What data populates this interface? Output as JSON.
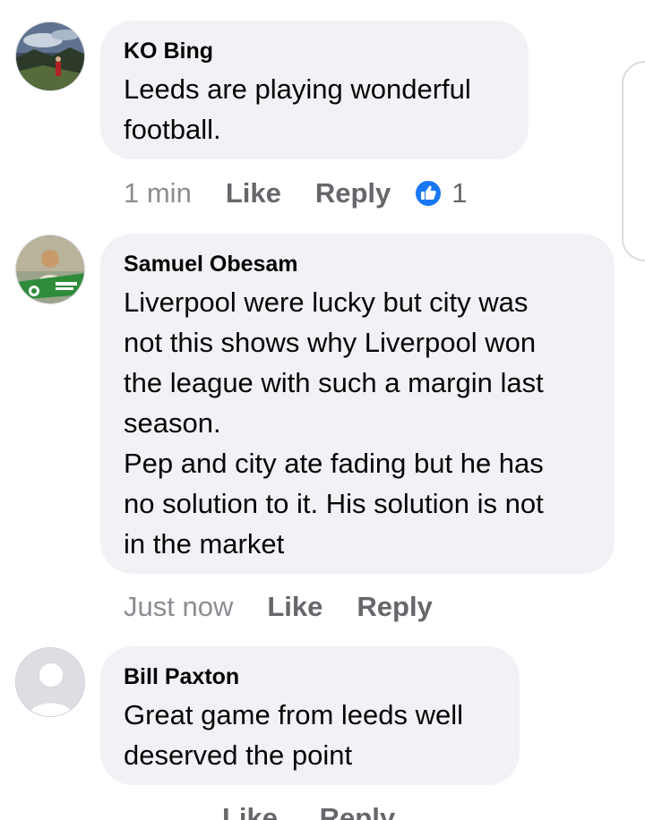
{
  "comments": [
    {
      "author": "KO Bing",
      "text": "Leeds are playing wonderful\nfootball.",
      "time": "1 min",
      "like_label": "Like",
      "reply_label": "Reply",
      "reaction_count": "1",
      "reaction_icon": "like-reaction-icon"
    },
    {
      "author": "Samuel Obesam",
      "text": "Liverpool were lucky but city was\nnot this shows why Liverpool won\nthe league with such a margin last\nseason.\nPep and city ate fading but he has\nno solution to it. His solution is not\nin the market",
      "time": "Just now",
      "like_label": "Like",
      "reply_label": "Reply"
    },
    {
      "author": "Bill Paxton",
      "text": "Great game from leeds well\ndeserved the point",
      "time": "",
      "like_label": "Like",
      "reply_label": "Reply"
    }
  ],
  "colors": {
    "bubble": "#f0f2f5",
    "author": "#050505",
    "meta": "#65676b",
    "reaction_blue": "#1877f2"
  }
}
